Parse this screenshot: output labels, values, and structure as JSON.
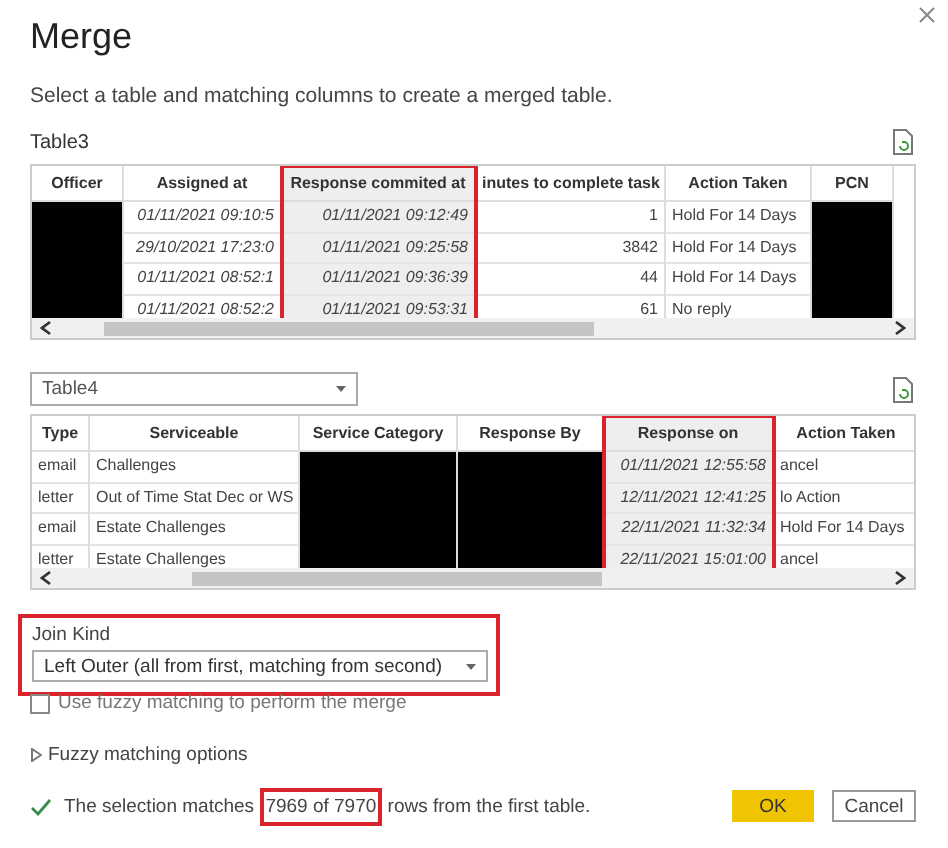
{
  "dialog": {
    "title": "Merge",
    "subtitle": "Select a table and matching columns to create a merged table."
  },
  "first_table": {
    "label": "Table3",
    "columns": [
      {
        "header": "Officer",
        "kind": "redacted",
        "highlighted": false
      },
      {
        "header": "Assigned at",
        "kind": "date",
        "highlighted": false,
        "cells": [
          "01/11/2021 09:10:5",
          "29/10/2021 17:23:0",
          "01/11/2021 08:52:1",
          "01/11/2021 08:52:2"
        ]
      },
      {
        "header": "Response commited at",
        "kind": "date",
        "highlighted": true,
        "cells": [
          "01/11/2021 09:12:49",
          "01/11/2021 09:25:58",
          "01/11/2021 09:36:39",
          "01/11/2021 09:53:31"
        ]
      },
      {
        "header": "inutes to complete task",
        "kind": "number",
        "highlighted": false,
        "cells": [
          "1",
          "3842",
          "44",
          "61"
        ]
      },
      {
        "header": "Action Taken",
        "kind": "text",
        "highlighted": false,
        "cells": [
          "Hold For 14 Days",
          "Hold For 14 Days",
          "Hold For 14 Days",
          "No reply"
        ]
      },
      {
        "header": "PCN",
        "kind": "redacted",
        "highlighted": false
      }
    ]
  },
  "second_table": {
    "selector": {
      "value": "Table4"
    },
    "columns": [
      {
        "header": "Type",
        "kind": "text",
        "highlighted": false,
        "cells": [
          "email",
          "letter",
          "email",
          "letter"
        ]
      },
      {
        "header": "Serviceable",
        "kind": "text",
        "highlighted": false,
        "cells": [
          "Challenges",
          "Out of Time Stat Dec or WS",
          "Estate Challenges",
          "Estate Challenges"
        ]
      },
      {
        "header": "Service Category",
        "kind": "redacted",
        "highlighted": false
      },
      {
        "header": "Response By",
        "kind": "redacted",
        "highlighted": false
      },
      {
        "header": "Response on",
        "kind": "date",
        "highlighted": true,
        "cells": [
          "01/11/2021 12:55:58",
          "12/11/2021 12:41:25",
          "22/11/2021 11:32:34",
          "22/11/2021 15:01:00"
        ]
      },
      {
        "header": "Action Taken",
        "kind": "text",
        "highlighted": false,
        "cells": [
          "ancel",
          "lo Action",
          "Hold For 14 Days",
          "ancel"
        ]
      }
    ]
  },
  "join_kind": {
    "label": "Join Kind",
    "value": "Left Outer (all from first, matching from second)",
    "highlighted": true
  },
  "fuzzy_checkbox": {
    "label": "Use fuzzy matching to perform the merge",
    "checked": false
  },
  "fuzzy_options": {
    "label": "Fuzzy matching options",
    "expanded": false
  },
  "status": {
    "before": "The selection matches ",
    "highlight": "7969 of 7970",
    "after": " rows from the first table."
  },
  "buttons": [
    {
      "label": "OK",
      "kind": "primary"
    },
    {
      "label": "Cancel",
      "kind": "secondary"
    }
  ]
}
